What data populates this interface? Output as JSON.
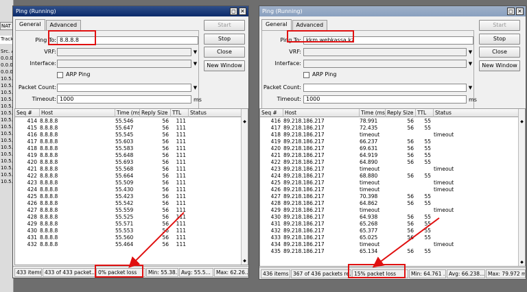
{
  "background": {
    "tabs": [
      "NAT",
      "Track"
    ],
    "lines": [
      "Src. A",
      "0.0.0.",
      "0.0.0.",
      "0.0.0.",
      "10.5.5",
      "10.5.5",
      "10.5.5",
      "10.5.5",
      "10.5.5",
      "10.5.5",
      "10.5.5",
      "10.5.5",
      "10.5.5",
      "10.5.5",
      "10.5.5",
      "10.5.5",
      "10.5.5",
      "10.5.5",
      "10.5.5",
      "10.5.5"
    ]
  },
  "colors": {
    "highlight": "#e01010",
    "active_title": "#0b2a6a",
    "inactive_title": "#8aa0bf"
  },
  "windows": [
    {
      "title": "Ping (Running)",
      "title_buttons": [
        "◻",
        "✕"
      ],
      "tabs": [
        "General",
        "Advanced"
      ],
      "fields": {
        "ping_to_label": "Ping To:",
        "ping_to_value": "8.8.8.8",
        "vrf_label": "VRF:",
        "vrf_value": "",
        "interface_label": "Interface:",
        "interface_value": "",
        "arp_ping_label": "ARP Ping",
        "packet_count_label": "Packet Count:",
        "packet_count_value": "",
        "timeout_label": "Timeout:",
        "timeout_value": "1000",
        "timeout_unit": "ms"
      },
      "buttons": {
        "start": "Start",
        "stop": "Stop",
        "close": "Close",
        "new_window": "New Window"
      },
      "columns": {
        "seq": "Seq #",
        "host": "Host",
        "time": "Time (ms)",
        "reply_size": "Reply Size",
        "ttl": "TTL",
        "status": "Status"
      },
      "rows": [
        {
          "seq": "414",
          "host": "8.8.8.8",
          "time": "55.546",
          "size": "56",
          "ttl": "111",
          "status": ""
        },
        {
          "seq": "415",
          "host": "8.8.8.8",
          "time": "55.647",
          "size": "56",
          "ttl": "111",
          "status": ""
        },
        {
          "seq": "416",
          "host": "8.8.8.8",
          "time": "55.545",
          "size": "56",
          "ttl": "111",
          "status": ""
        },
        {
          "seq": "417",
          "host": "8.8.8.8",
          "time": "55.603",
          "size": "56",
          "ttl": "111",
          "status": ""
        },
        {
          "seq": "418",
          "host": "8.8.8.8",
          "time": "55.583",
          "size": "56",
          "ttl": "111",
          "status": ""
        },
        {
          "seq": "419",
          "host": "8.8.8.8",
          "time": "55.648",
          "size": "56",
          "ttl": "111",
          "status": ""
        },
        {
          "seq": "420",
          "host": "8.8.8.8",
          "time": "55.693",
          "size": "56",
          "ttl": "111",
          "status": ""
        },
        {
          "seq": "421",
          "host": "8.8.8.8",
          "time": "55.568",
          "size": "56",
          "ttl": "111",
          "status": ""
        },
        {
          "seq": "422",
          "host": "8.8.8.8",
          "time": "55.664",
          "size": "56",
          "ttl": "111",
          "status": ""
        },
        {
          "seq": "423",
          "host": "8.8.8.8",
          "time": "55.509",
          "size": "56",
          "ttl": "111",
          "status": ""
        },
        {
          "seq": "424",
          "host": "8.8.8.8",
          "time": "55.430",
          "size": "56",
          "ttl": "111",
          "status": ""
        },
        {
          "seq": "425",
          "host": "8.8.8.8",
          "time": "55.423",
          "size": "56",
          "ttl": "111",
          "status": ""
        },
        {
          "seq": "426",
          "host": "8.8.8.8",
          "time": "55.542",
          "size": "56",
          "ttl": "111",
          "status": ""
        },
        {
          "seq": "427",
          "host": "8.8.8.8",
          "time": "55.559",
          "size": "56",
          "ttl": "111",
          "status": ""
        },
        {
          "seq": "428",
          "host": "8.8.8.8",
          "time": "55.525",
          "size": "56",
          "ttl": "111",
          "status": ""
        },
        {
          "seq": "429",
          "host": "8.8.8.8",
          "time": "55.571",
          "size": "56",
          "ttl": "111",
          "status": ""
        },
        {
          "seq": "430",
          "host": "8.8.8.8",
          "time": "55.553",
          "size": "56",
          "ttl": "111",
          "status": ""
        },
        {
          "seq": "431",
          "host": "8.8.8.8",
          "time": "55.560",
          "size": "56",
          "ttl": "111",
          "status": ""
        },
        {
          "seq": "432",
          "host": "8.8.8.8",
          "time": "55.464",
          "size": "56",
          "ttl": "111",
          "status": ""
        }
      ],
      "status_bar": [
        "433 items",
        "433 of 433 packet...",
        "0% packet loss",
        "Min: 55.38...",
        "Avg: 55.5...",
        "Max: 62.26..."
      ]
    },
    {
      "title": "Ping (Running)",
      "title_buttons": [
        "◻",
        "✕"
      ],
      "tabs": [
        "General",
        "Advanced"
      ],
      "fields": {
        "ping_to_label": "Ping To:",
        "ping_to_value": "kkm.webkassa.kz",
        "vrf_label": "VRF:",
        "vrf_value": "",
        "interface_label": "Interface:",
        "interface_value": "",
        "arp_ping_label": "ARP Ping",
        "packet_count_label": "Packet Count:",
        "packet_count_value": "",
        "timeout_label": "Timeout:",
        "timeout_value": "1000",
        "timeout_unit": "ms"
      },
      "buttons": {
        "start": "Start",
        "stop": "Stop",
        "close": "Close",
        "new_window": "New Window"
      },
      "columns": {
        "seq": "Seq #",
        "host": "Host",
        "time": "Time (ms)",
        "reply_size": "Reply Size",
        "ttl": "TTL",
        "status": "Status"
      },
      "rows": [
        {
          "seq": "416",
          "host": "89.218.186.217",
          "time": "78.991",
          "size": "56",
          "ttl": "55",
          "status": ""
        },
        {
          "seq": "417",
          "host": "89.218.186.217",
          "time": "72.435",
          "size": "56",
          "ttl": "55",
          "status": ""
        },
        {
          "seq": "418",
          "host": "89.218.186.217",
          "time": "timeout",
          "size": "",
          "ttl": "",
          "status": "timeout"
        },
        {
          "seq": "419",
          "host": "89.218.186.217",
          "time": "66.237",
          "size": "56",
          "ttl": "55",
          "status": ""
        },
        {
          "seq": "420",
          "host": "89.218.186.217",
          "time": "69.631",
          "size": "56",
          "ttl": "55",
          "status": ""
        },
        {
          "seq": "421",
          "host": "89.218.186.217",
          "time": "64.919",
          "size": "56",
          "ttl": "55",
          "status": ""
        },
        {
          "seq": "422",
          "host": "89.218.186.217",
          "time": "64.890",
          "size": "56",
          "ttl": "55",
          "status": ""
        },
        {
          "seq": "423",
          "host": "89.218.186.217",
          "time": "timeout",
          "size": "",
          "ttl": "",
          "status": "timeout"
        },
        {
          "seq": "424",
          "host": "89.218.186.217",
          "time": "68.880",
          "size": "56",
          "ttl": "55",
          "status": ""
        },
        {
          "seq": "425",
          "host": "89.218.186.217",
          "time": "timeout",
          "size": "",
          "ttl": "",
          "status": "timeout"
        },
        {
          "seq": "426",
          "host": "89.218.186.217",
          "time": "timeout",
          "size": "",
          "ttl": "",
          "status": "timeout"
        },
        {
          "seq": "427",
          "host": "89.218.186.217",
          "time": "70.398",
          "size": "56",
          "ttl": "55",
          "status": ""
        },
        {
          "seq": "428",
          "host": "89.218.186.217",
          "time": "64.862",
          "size": "56",
          "ttl": "55",
          "status": ""
        },
        {
          "seq": "429",
          "host": "89.218.186.217",
          "time": "timeout",
          "size": "",
          "ttl": "",
          "status": "timeout"
        },
        {
          "seq": "430",
          "host": "89.218.186.217",
          "time": "64.938",
          "size": "56",
          "ttl": "55",
          "status": ""
        },
        {
          "seq": "431",
          "host": "89.218.186.217",
          "time": "65.268",
          "size": "56",
          "ttl": "55",
          "status": ""
        },
        {
          "seq": "432",
          "host": "89.218.186.217",
          "time": "65.377",
          "size": "56",
          "ttl": "55",
          "status": ""
        },
        {
          "seq": "433",
          "host": "89.218.186.217",
          "time": "65.025",
          "size": "56",
          "ttl": "55",
          "status": ""
        },
        {
          "seq": "434",
          "host": "89.218.186.217",
          "time": "timeout",
          "size": "",
          "ttl": "",
          "status": "timeout"
        },
        {
          "seq": "435",
          "host": "89.218.186.217",
          "time": "65.134",
          "size": "56",
          "ttl": "55",
          "status": ""
        }
      ],
      "status_bar": [
        "436 items",
        "367 of 436 packets re...",
        "15% packet loss",
        "Min: 64.761 ...",
        "Avg: 66.238...",
        "Max: 79.972 ms"
      ]
    }
  ]
}
